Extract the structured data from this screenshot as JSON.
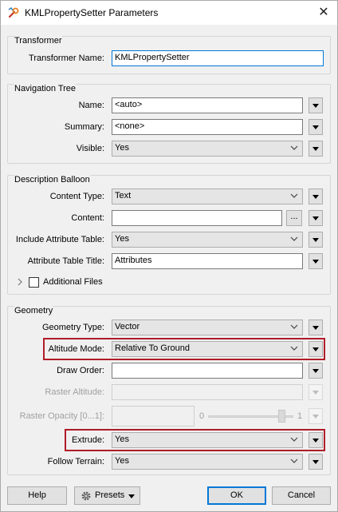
{
  "window": {
    "title": "KMLPropertySetter Parameters",
    "icon": "transformer-wrench-icon",
    "close_icon": "close-icon"
  },
  "transformer": {
    "legend": "Transformer",
    "name_label": "Transformer Name:",
    "name_value": "KMLPropertySetter"
  },
  "navigation_tree": {
    "legend": "Navigation Tree",
    "name_label": "Name:",
    "name_value": "<auto>",
    "summary_label": "Summary:",
    "summary_value": "<none>",
    "visible_label": "Visible:",
    "visible_value": "Yes"
  },
  "description_balloon": {
    "legend": "Description Balloon",
    "content_type_label": "Content Type:",
    "content_type_value": "Text",
    "content_label": "Content:",
    "content_value": "",
    "ellipsis_label": "...",
    "include_attr_label": "Include Attribute Table:",
    "include_attr_value": "Yes",
    "attr_title_label": "Attribute Table Title:",
    "attr_title_value": "Attributes",
    "additional_files_label": "Additional Files",
    "additional_files_checked": false
  },
  "geometry": {
    "legend": "Geometry",
    "geometry_type_label": "Geometry Type:",
    "geometry_type_value": "Vector",
    "altitude_mode_label": "Altitude Mode:",
    "altitude_mode_value": "Relative To Ground",
    "draw_order_label": "Draw Order:",
    "draw_order_value": "",
    "raster_altitude_label": "Raster Altitude:",
    "raster_altitude_value": "",
    "raster_opacity_label": "Raster Opacity [0...1]:",
    "raster_opacity_value": "",
    "raster_opacity_min": "0",
    "raster_opacity_max": "1",
    "raster_opacity_level": 0.9,
    "extrude_label": "Extrude:",
    "extrude_value": "Yes",
    "follow_terrain_label": "Follow Terrain:",
    "follow_terrain_value": "Yes"
  },
  "footer": {
    "help_label": "Help",
    "presets_label": "Presets",
    "presets_icon": "gear-icon",
    "ok_label": "OK",
    "cancel_label": "Cancel"
  },
  "colors": {
    "highlight": "#b01c28",
    "focus": "#0078d7"
  }
}
